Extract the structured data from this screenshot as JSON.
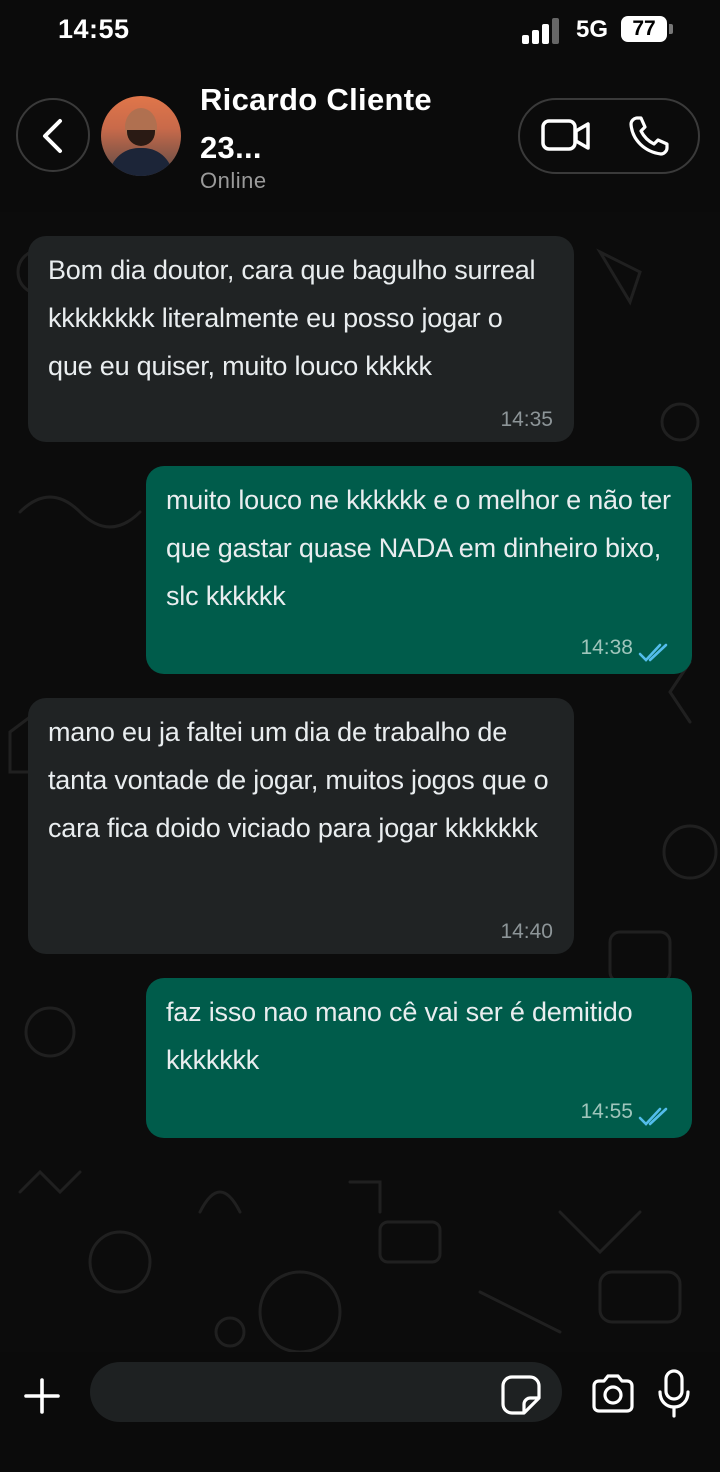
{
  "status_bar": {
    "time": "14:55",
    "network": "5G",
    "battery": "77"
  },
  "header": {
    "contact_name": "Ricardo Cliente 23...",
    "contact_status": "Online",
    "icons": {
      "back": "chevron-left-icon",
      "video": "video-camera-icon",
      "voice": "phone-icon"
    }
  },
  "messages": [
    {
      "direction": "in",
      "text": "Bom dia doutor, cara que bagulho surreal kkkkkkkk literalmente eu posso jogar o que eu quiser, muito louco kkkkk",
      "time": "14:35"
    },
    {
      "direction": "out",
      "text": "muito louco ne kkkkkk e o melhor e não ter que gastar quase NADA em dinheiro bixo, slc kkkkkk",
      "time": "14:38",
      "read": true
    },
    {
      "direction": "in",
      "text": "mano eu ja faltei um dia de trabalho de tanta vontade de jogar, muitos jogos que o cara fica doido viciado para jogar kkkkkkk",
      "time": "14:40"
    },
    {
      "direction": "out",
      "text": "faz isso nao mano cê vai ser é demitido kkkkkkk",
      "time": "14:55",
      "read": true
    }
  ],
  "input_bar": {
    "message_value": "",
    "icons": {
      "attach": "plus-icon",
      "sticker": "sticker-icon",
      "camera": "camera-icon",
      "mic": "microphone-icon"
    }
  },
  "colors": {
    "incoming_bubble": "#202324",
    "outgoing_bubble": "#005c4b",
    "read_ticks": "#53bdeb",
    "background": "#0b0b0b"
  }
}
